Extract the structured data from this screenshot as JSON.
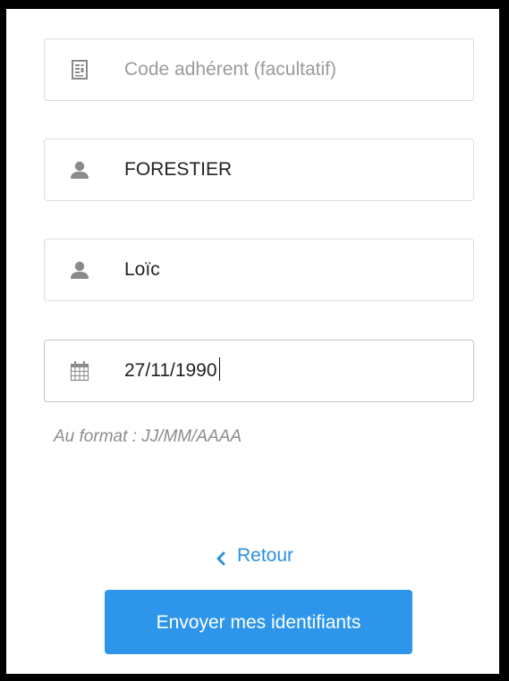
{
  "form": {
    "member_code": {
      "placeholder": "Code adhérent (facultatif)",
      "value": "",
      "icon": "id-card-icon"
    },
    "last_name": {
      "value": "FORESTIER",
      "icon": "user-icon"
    },
    "first_name": {
      "value": "Loïc",
      "icon": "user-icon"
    },
    "birth_date": {
      "value": "27/11/1990",
      "icon": "calendar-icon",
      "hint": "Au format : JJ/MM/AAAA"
    }
  },
  "actions": {
    "back_label": "Retour",
    "back_icon": "chevron-left-icon",
    "submit_label": "Envoyer mes identifiants"
  },
  "colors": {
    "accent": "#2e96ea",
    "link": "#2b8fde",
    "icon": "#8a8a8a",
    "border": "#dcdcdc",
    "frame": "#000000"
  }
}
